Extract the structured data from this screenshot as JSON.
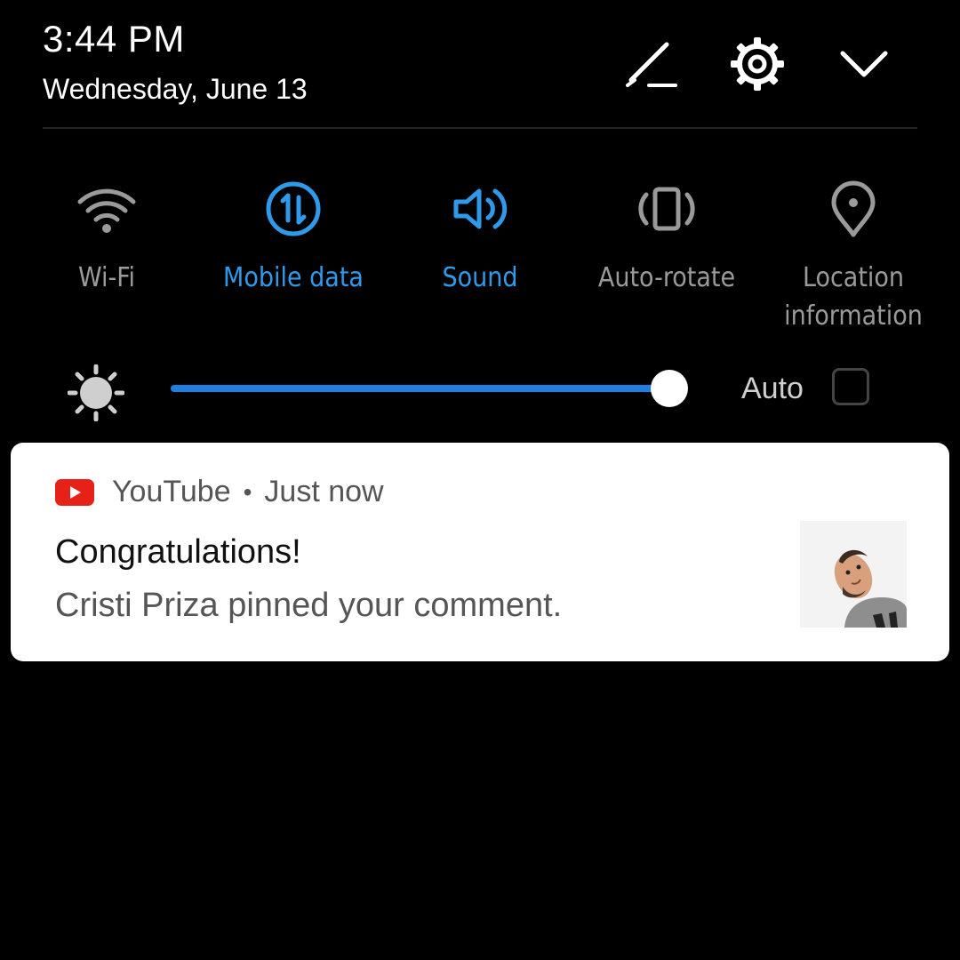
{
  "header": {
    "time": "3:44 PM",
    "date": "Wednesday, June 13",
    "actions": [
      {
        "name": "edit-icon"
      },
      {
        "name": "settings-gear-icon"
      },
      {
        "name": "chevron-down-icon"
      }
    ]
  },
  "quick_tiles": [
    {
      "label": "Wi-Fi",
      "icon": "wifi-icon",
      "active": false
    },
    {
      "label": "Mobile data",
      "icon": "mobile-data-icon",
      "active": true
    },
    {
      "label": "Sound",
      "icon": "sound-icon",
      "active": true
    },
    {
      "label": "Auto-rotate",
      "icon": "auto-rotate-icon",
      "active": false
    },
    {
      "label": "Location\ninformation",
      "icon": "location-icon",
      "active": false
    }
  ],
  "brightness": {
    "icon": "brightness-sun-icon",
    "level": 0.97,
    "auto_label": "Auto",
    "auto_checked": false
  },
  "notification": {
    "app_name": "YouTube",
    "separator": "•",
    "time": "Just now",
    "title": "Congratulations!",
    "body": "Cristi Priza pinned your comment.",
    "thumbnail": "user-avatar"
  },
  "colors": {
    "active": "#2f9aea",
    "inactive": "#9a9a9a",
    "slider_fill": "#1e7fe0",
    "youtube_red": "#e62117"
  }
}
